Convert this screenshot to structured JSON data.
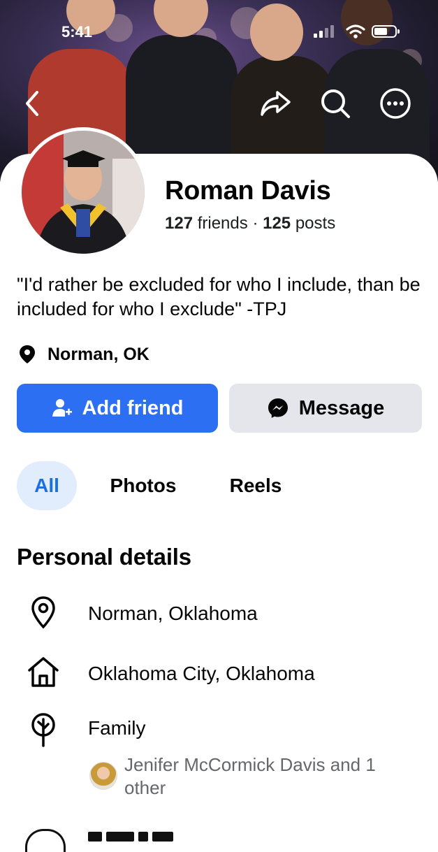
{
  "status_bar": {
    "time": "5:41"
  },
  "profile": {
    "name": "Roman Davis",
    "friends_count": "127",
    "friends_label": "friends",
    "separator": "·",
    "posts_count": "125",
    "posts_label": "posts",
    "bio": "\"I'd rather be excluded for who I include, than be included for who I exclude\" -TPJ",
    "location": "Norman, OK"
  },
  "actions": {
    "add_friend_label": "Add friend",
    "message_label": "Message"
  },
  "tabs": [
    {
      "label": "All",
      "active": true
    },
    {
      "label": "Photos",
      "active": false
    },
    {
      "label": "Reels",
      "active": false
    }
  ],
  "personal_details": {
    "title": "Personal details",
    "items": [
      {
        "icon": "map-pin-icon",
        "text": "Norman, Oklahoma"
      },
      {
        "icon": "home-icon",
        "text": "Oklahoma City, Oklahoma"
      },
      {
        "icon": "family-tree-icon",
        "text": "Family"
      }
    ],
    "family_sub": "Jenifer McCormick Davis and 1 other"
  },
  "colors": {
    "primary_blue": "#2d6ff3",
    "tab_active_bg": "#e1edfc",
    "tab_active_text": "#1a6fe1",
    "secondary_button": "#e4e6eb",
    "muted_text": "#65676b"
  }
}
